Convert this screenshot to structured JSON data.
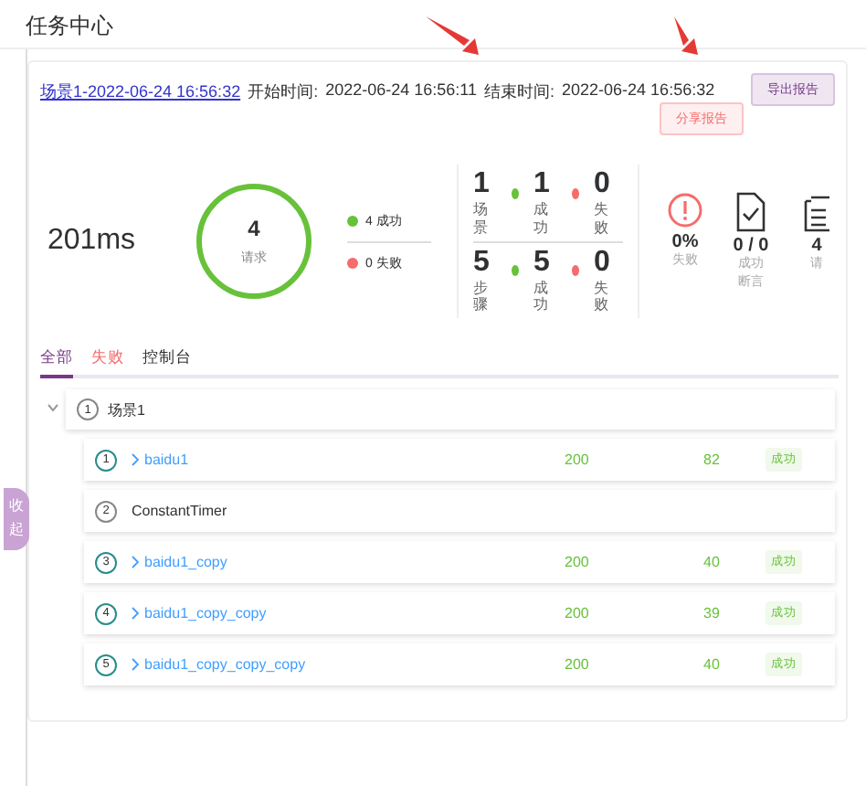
{
  "page_title": "任务中心",
  "report": {
    "name": "场景1-2022-06-24 16:56:32",
    "start_label": "开始时间:",
    "start_time": "2022-06-24 16:56:11",
    "end_label": "结束时间:",
    "end_time": "2022-06-24 16:56:32"
  },
  "buttons": [
    {
      "label": "分享报告",
      "kind": "share"
    },
    {
      "label": "导出报告",
      "kind": "export"
    }
  ],
  "avg_time": "201ms",
  "ring": {
    "value": "4",
    "label": "请求",
    "level": 1
  },
  "legend": [
    {
      "label": "4 成功",
      "color": "#67c23a"
    },
    {
      "label": "0 失败",
      "color": "#f56c6c"
    }
  ],
  "stats_grid": [
    {
      "cells": [
        {
          "value": "1",
          "label": "场景"
        },
        {
          "value": "1",
          "label": "成功",
          "color": "#67c23a"
        },
        {
          "value": "0",
          "label": "失败",
          "color": "#f56c6c"
        }
      ]
    },
    {
      "cells": [
        {
          "value": "5",
          "label": "步骤"
        },
        {
          "value": "5",
          "label": "成功",
          "color": "#67c23a"
        },
        {
          "value": "0",
          "label": "失败",
          "color": "#f56c6c"
        }
      ]
    }
  ],
  "metrics": [
    {
      "kind": "alert",
      "value": "0%",
      "label": "失败"
    },
    {
      "kind": "doc-check",
      "value": "0 / 0",
      "label": "成功断言"
    },
    {
      "kind": "clipboard",
      "value": "4",
      "label": "请"
    }
  ],
  "tabs": [
    {
      "label": "全部",
      "selected": true,
      "color": "#783887"
    },
    {
      "label": "失败",
      "selected": false,
      "color": "#f56c6c"
    },
    {
      "label": "控制台",
      "selected": false,
      "color": "#303133"
    }
  ],
  "tree": [
    {
      "index": "1",
      "name": "场景1",
      "expanded": true,
      "children": [
        {
          "kind": "request",
          "index": "1",
          "name": "baidu1",
          "code": "200",
          "time": "82",
          "status": "成功"
        },
        {
          "kind": "timer",
          "index": "2",
          "name": "ConstantTimer"
        },
        {
          "kind": "request",
          "index": "3",
          "name": "baidu1_copy",
          "code": "200",
          "time": "40",
          "status": "成功"
        },
        {
          "kind": "request",
          "index": "4",
          "name": "baidu1_copy_copy",
          "code": "200",
          "time": "39",
          "status": "成功"
        },
        {
          "kind": "request",
          "index": "5",
          "name": "baidu1_copy_copy_copy",
          "code": "200",
          "time": "40",
          "status": "成功"
        }
      ]
    }
  ],
  "collapse_tab": "收起"
}
